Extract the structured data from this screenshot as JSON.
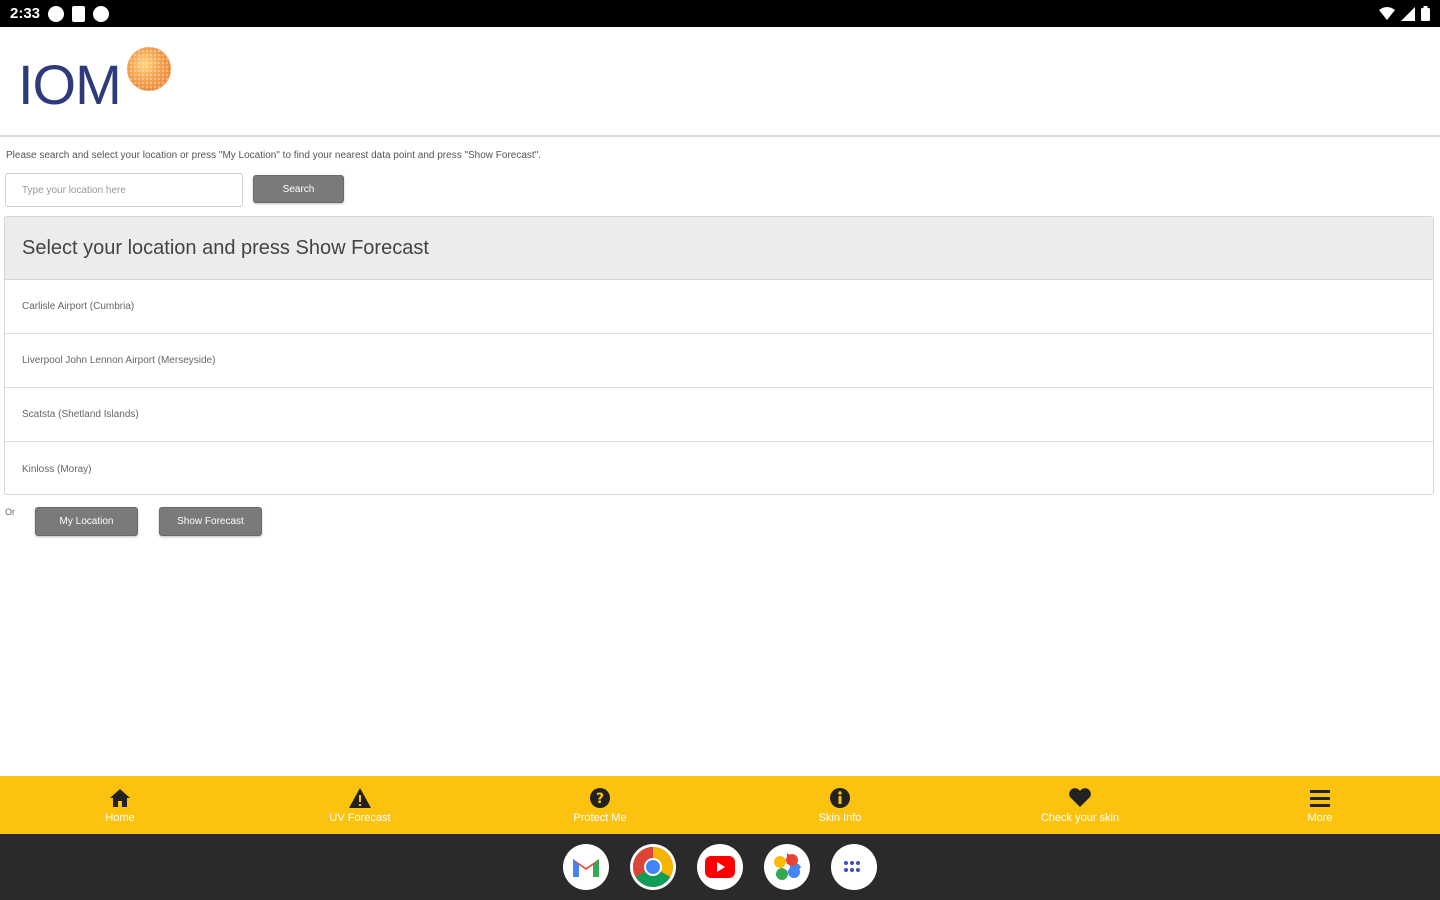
{
  "status_bar": {
    "time": "2:33"
  },
  "header": {
    "logo_text": "IOM"
  },
  "main": {
    "instructions": "Please search and select your location or press \"My Location\" to find your nearest data point and press \"Show Forecast\".",
    "search_placeholder": "Type your location here",
    "search_button": "Search",
    "list_title": "Select your location and press Show Forecast",
    "locations": [
      "Carlisle Airport (Cumbria)",
      "Liverpool John Lennon Airport (Merseyside)",
      "Scatsta (Shetland Islands)",
      "Kinloss (Moray)"
    ],
    "or_label": "Or",
    "my_location_button": "My Location",
    "show_forecast_button": "Show Forecast"
  },
  "bottom_nav": {
    "items": [
      {
        "label": "Home",
        "icon": "home-icon"
      },
      {
        "label": "UV Forecast",
        "icon": "warning-icon"
      },
      {
        "label": "Protect Me",
        "icon": "question-icon"
      },
      {
        "label": "Skin Info",
        "icon": "info-icon"
      },
      {
        "label": "Check your skin",
        "icon": "heart-icon"
      },
      {
        "label": "More",
        "icon": "menu-icon"
      }
    ]
  },
  "dock": {
    "apps": [
      "gmail-icon",
      "chrome-icon",
      "youtube-icon",
      "photos-icon",
      "app-drawer-icon"
    ]
  },
  "colors": {
    "nav_background": "#fbc30f",
    "button_background": "#7a7a7a",
    "logo_blue": "#2e3a7c",
    "logo_orange": "#f5a04a"
  }
}
